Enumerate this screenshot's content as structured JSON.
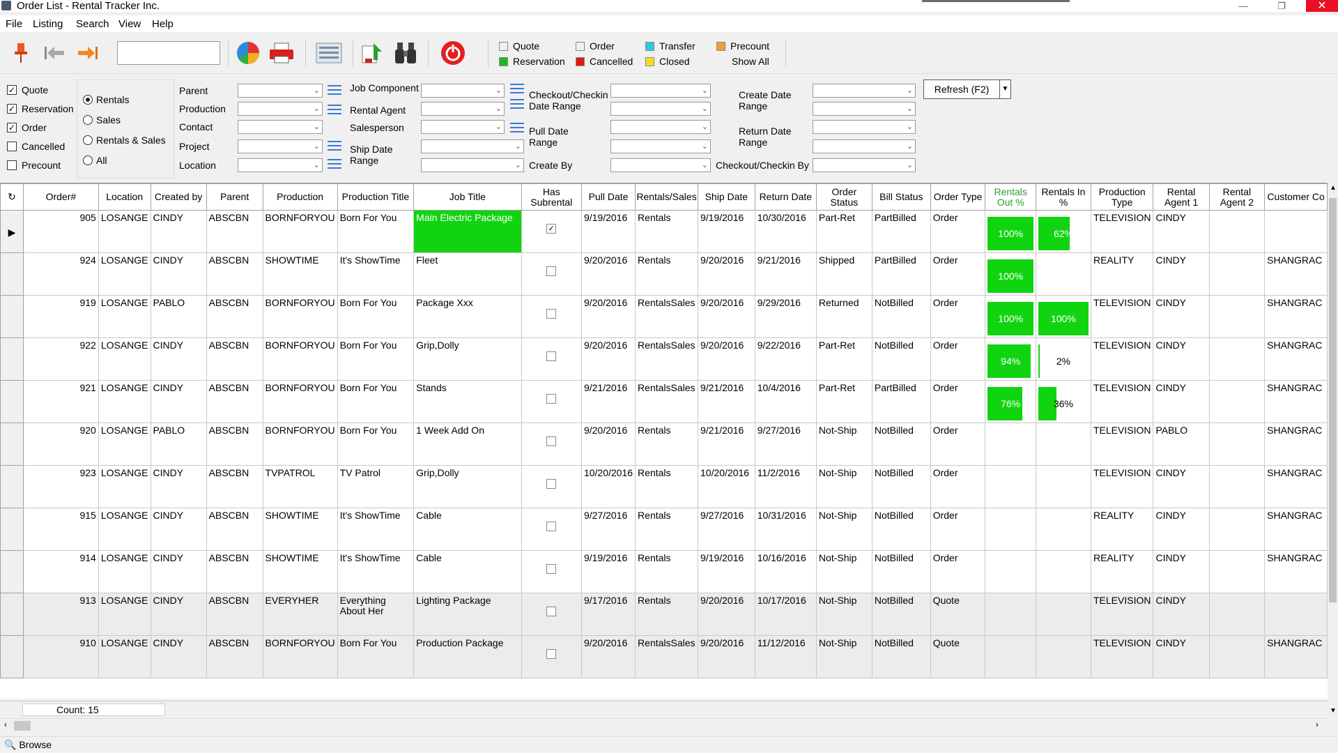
{
  "window": {
    "title": "Order List - Rental Tracker Inc."
  },
  "menu": [
    "File",
    "Listing",
    "Search",
    "View",
    "Help"
  ],
  "toolbar": {
    "search_value": "",
    "legend": [
      {
        "label": "Quote",
        "color": "#ffffff"
      },
      {
        "label": "Order",
        "color": "#ffffff"
      },
      {
        "label": "Transfer",
        "color": "#30c8e0"
      },
      {
        "label": "Precount",
        "color": "#f0a030"
      },
      {
        "label": "Reservation",
        "color": "#22b422"
      },
      {
        "label": "Cancelled",
        "color": "#e01818"
      },
      {
        "label": "Closed",
        "color": "#f0e020"
      }
    ],
    "show_all_label": "Show All",
    "icons": [
      "pin-icon",
      "back-icon",
      "forward-icon",
      "chart-icon",
      "print-icon",
      "list-view-icon",
      "export-icon",
      "binoculars-icon",
      "power-icon"
    ]
  },
  "filters": {
    "type_checks": [
      {
        "label": "Quote",
        "checked": true
      },
      {
        "label": "Reservation",
        "checked": true
      },
      {
        "label": "Order",
        "checked": true
      },
      {
        "label": "Cancelled",
        "checked": false
      },
      {
        "label": "Precount",
        "checked": false
      }
    ],
    "mode_radios": [
      {
        "label": "Rentals",
        "selected": true
      },
      {
        "label": "Sales",
        "selected": false
      },
      {
        "label": "Rentals & Sales",
        "selected": false
      },
      {
        "label": "All",
        "selected": false
      }
    ],
    "col1": [
      "Parent",
      "Production",
      "Contact",
      "Project",
      "Location"
    ],
    "col2": [
      "Job Component",
      "Rental Agent",
      "Salesperson",
      "Ship Date Range"
    ],
    "col3": [
      "Checkout/Checkin Date Range",
      "Pull Date Range",
      "Create By"
    ],
    "col4": [
      "Create Date Range",
      "Return Date Range",
      "Checkout/Checkin By"
    ],
    "refresh_label": "Refresh (F2)"
  },
  "grid": {
    "columns": [
      "Order#",
      "Location",
      "Created by",
      "Parent",
      "Production",
      "Production Title",
      "Job Title",
      "Has Subrental",
      "Pull Date",
      "Rentals/Sales",
      "Ship Date",
      "Return Date",
      "Order Status",
      "Bill Status",
      "Order Type",
      "Rentals Out %",
      "Rentals In %",
      "Production Type",
      "Rental Agent 1",
      "Rental Agent 2",
      "Customer Co"
    ],
    "sorted_column": "Rentals Out %",
    "rows": [
      {
        "order": "905",
        "location": "LOSANGE",
        "created_by": "CINDY",
        "parent": "ABSCBN",
        "production": "BORNFORYOU",
        "prod_title": "Born For You",
        "job_title": "Main Electric Package",
        "has_sub": true,
        "pull": "9/19/2016",
        "rs": "Rentals",
        "ship": "9/19/2016",
        "ret": "10/30/2016",
        "status": "Part-Ret",
        "bill": "PartBilled",
        "type": "Order",
        "out_pct": 1.0,
        "out_label": "100%",
        "in_pct": 0.62,
        "in_label": "62%",
        "ptype": "TELEVISION",
        "agent1": "CINDY",
        "agent2": "",
        "customer": "",
        "job_highlight": true,
        "quote": false
      },
      {
        "order": "924",
        "location": "LOSANGE",
        "created_by": "CINDY",
        "parent": "ABSCBN",
        "production": "SHOWTIME",
        "prod_title": "It's ShowTime",
        "job_title": "Fleet",
        "has_sub": false,
        "pull": "9/20/2016",
        "rs": "Rentals",
        "ship": "9/20/2016",
        "ret": "9/21/2016",
        "status": "Shipped",
        "bill": "PartBilled",
        "type": "Order",
        "out_pct": 1.0,
        "out_label": "100%",
        "in_pct": null,
        "in_label": "",
        "ptype": "REALITY",
        "agent1": "CINDY",
        "agent2": "",
        "customer": "SHANGRAC",
        "job_highlight": false,
        "quote": false
      },
      {
        "order": "919",
        "location": "LOSANGE",
        "created_by": "PABLO",
        "parent": "ABSCBN",
        "production": "BORNFORYOU",
        "prod_title": "Born For You",
        "job_title": "Package Xxx",
        "has_sub": false,
        "pull": "9/20/2016",
        "rs": "RentalsSales",
        "ship": "9/20/2016",
        "ret": "9/29/2016",
        "status": "Returned",
        "bill": "NotBilled",
        "type": "Order",
        "out_pct": 1.0,
        "out_label": "100%",
        "in_pct": 1.0,
        "in_label": "100%",
        "ptype": "TELEVISION",
        "agent1": "CINDY",
        "agent2": "",
        "customer": "SHANGRAC",
        "job_highlight": false,
        "quote": false
      },
      {
        "order": "922",
        "location": "LOSANGE",
        "created_by": "CINDY",
        "parent": "ABSCBN",
        "production": "BORNFORYOU",
        "prod_title": "Born For You",
        "job_title": "Grip,Dolly",
        "has_sub": false,
        "pull": "9/20/2016",
        "rs": "RentalsSales",
        "ship": "9/20/2016",
        "ret": "9/22/2016",
        "status": "Part-Ret",
        "bill": "NotBilled",
        "type": "Order",
        "out_pct": 0.94,
        "out_label": "94%",
        "in_pct": 0.02,
        "in_label": "2%",
        "ptype": "TELEVISION",
        "agent1": "CINDY",
        "agent2": "",
        "customer": "SHANGRAC",
        "job_highlight": false,
        "quote": false
      },
      {
        "order": "921",
        "location": "LOSANGE",
        "created_by": "CINDY",
        "parent": "ABSCBN",
        "production": "BORNFORYOU",
        "prod_title": "Born For You",
        "job_title": "Stands",
        "has_sub": false,
        "pull": "9/21/2016",
        "rs": "RentalsSales",
        "ship": "9/21/2016",
        "ret": "10/4/2016",
        "status": "Part-Ret",
        "bill": "PartBilled",
        "type": "Order",
        "out_pct": 0.76,
        "out_label": "76%",
        "in_pct": 0.36,
        "in_label": "36%",
        "ptype": "TELEVISION",
        "agent1": "CINDY",
        "agent2": "",
        "customer": "SHANGRAC",
        "job_highlight": false,
        "quote": false
      },
      {
        "order": "920",
        "location": "LOSANGE",
        "created_by": "PABLO",
        "parent": "ABSCBN",
        "production": "BORNFORYOU",
        "prod_title": "Born For You",
        "job_title": "1 Week Add On",
        "has_sub": false,
        "pull": "9/20/2016",
        "rs": "Rentals",
        "ship": "9/21/2016",
        "ret": "9/27/2016",
        "status": "Not-Ship",
        "bill": "NotBilled",
        "type": "Order",
        "out_pct": null,
        "out_label": "",
        "in_pct": null,
        "in_label": "",
        "ptype": "TELEVISION",
        "agent1": "PABLO",
        "agent2": "",
        "customer": "SHANGRAC",
        "job_highlight": false,
        "quote": false
      },
      {
        "order": "923",
        "location": "LOSANGE",
        "created_by": "CINDY",
        "parent": "ABSCBN",
        "production": "TVPATROL",
        "prod_title": "TV Patrol",
        "job_title": "Grip,Dolly",
        "has_sub": false,
        "pull": "10/20/2016",
        "rs": "Rentals",
        "ship": "10/20/2016",
        "ret": "11/2/2016",
        "status": "Not-Ship",
        "bill": "NotBilled",
        "type": "Order",
        "out_pct": null,
        "out_label": "",
        "in_pct": null,
        "in_label": "",
        "ptype": "TELEVISION",
        "agent1": "CINDY",
        "agent2": "",
        "customer": "SHANGRAC",
        "job_highlight": false,
        "quote": false
      },
      {
        "order": "915",
        "location": "LOSANGE",
        "created_by": "CINDY",
        "parent": "ABSCBN",
        "production": "SHOWTIME",
        "prod_title": "It's ShowTime",
        "job_title": "Cable",
        "has_sub": false,
        "pull": "9/27/2016",
        "rs": "Rentals",
        "ship": "9/27/2016",
        "ret": "10/31/2016",
        "status": "Not-Ship",
        "bill": "NotBilled",
        "type": "Order",
        "out_pct": null,
        "out_label": "",
        "in_pct": null,
        "in_label": "",
        "ptype": "REALITY",
        "agent1": "CINDY",
        "agent2": "",
        "customer": "SHANGRAC",
        "job_highlight": false,
        "quote": false
      },
      {
        "order": "914",
        "location": "LOSANGE",
        "created_by": "CINDY",
        "parent": "ABSCBN",
        "production": "SHOWTIME",
        "prod_title": "It's ShowTime",
        "job_title": "Cable",
        "has_sub": false,
        "pull": "9/19/2016",
        "rs": "Rentals",
        "ship": "9/19/2016",
        "ret": "10/16/2016",
        "status": "Not-Ship",
        "bill": "NotBilled",
        "type": "Order",
        "out_pct": null,
        "out_label": "",
        "in_pct": null,
        "in_label": "",
        "ptype": "REALITY",
        "agent1": "CINDY",
        "agent2": "",
        "customer": "SHANGRAC",
        "job_highlight": false,
        "quote": false
      },
      {
        "order": "913",
        "location": "LOSANGE",
        "created_by": "CINDY",
        "parent": "ABSCBN",
        "production": "EVERYHER",
        "prod_title": "Everything About Her",
        "job_title": "Lighting Package",
        "has_sub": false,
        "pull": "9/17/2016",
        "rs": "Rentals",
        "ship": "9/20/2016",
        "ret": "10/17/2016",
        "status": "Not-Ship",
        "bill": "NotBilled",
        "type": "Quote",
        "out_pct": null,
        "out_label": "",
        "in_pct": null,
        "in_label": "",
        "ptype": "TELEVISION",
        "agent1": "CINDY",
        "agent2": "",
        "customer": "",
        "job_highlight": false,
        "quote": true
      },
      {
        "order": "910",
        "location": "LOSANGE",
        "created_by": "CINDY",
        "parent": "ABSCBN",
        "production": "BORNFORYOU",
        "prod_title": "Born For You",
        "job_title": "Production Package",
        "has_sub": false,
        "pull": "9/20/2016",
        "rs": "RentalsSales",
        "ship": "9/20/2016",
        "ret": "11/12/2016",
        "status": "Not-Ship",
        "bill": "NotBilled",
        "type": "Quote",
        "out_pct": null,
        "out_label": "",
        "in_pct": null,
        "in_label": "",
        "ptype": "TELEVISION",
        "agent1": "CINDY",
        "agent2": "",
        "customer": "SHANGRAC",
        "job_highlight": false,
        "quote": true
      }
    ],
    "count_label": "Count: 15"
  },
  "status": {
    "mode": "Browse"
  }
}
